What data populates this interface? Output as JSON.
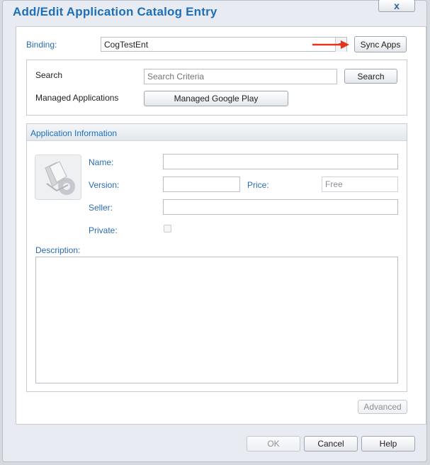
{
  "dialog": {
    "title": "Add/Edit Application Catalog Entry",
    "close_label": "x"
  },
  "binding": {
    "label": "Binding:",
    "value": "CogTestEnt",
    "sync_label": "Sync Apps"
  },
  "search": {
    "label": "Search",
    "placeholder": "Search Criteria",
    "button_label": "Search",
    "managed_label": "Managed Applications",
    "managed_button": "Managed Google Play"
  },
  "app_info": {
    "title": "Application Information",
    "name_label": "Name:",
    "name_value": "",
    "version_label": "Version:",
    "version_value": "",
    "price_label": "Price:",
    "price_value": "Free",
    "seller_label": "Seller:",
    "seller_value": "",
    "private_label": "Private:",
    "private_checked": false,
    "description_label": "Description:",
    "description_value": "",
    "advanced_label": "Advanced"
  },
  "footer": {
    "ok_label": "OK",
    "cancel_label": "Cancel",
    "help_label": "Help"
  },
  "colors": {
    "accent": "#1d6fb8",
    "arrow": "#e8321d"
  }
}
